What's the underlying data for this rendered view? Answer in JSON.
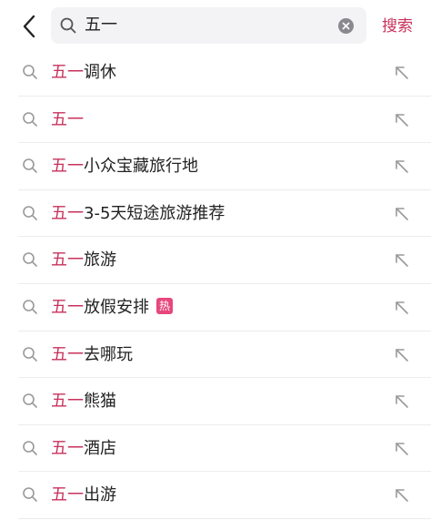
{
  "header": {
    "query": "五一",
    "search_label": "搜索"
  },
  "colors": {
    "accent": "#c7315c",
    "hot_badge": "#e6477d"
  },
  "suggestions": [
    {
      "prefix": "五一",
      "suffix": "调休",
      "badge": ""
    },
    {
      "prefix": "五一",
      "suffix": "",
      "badge": ""
    },
    {
      "prefix": "五一",
      "suffix": "小众宝藏旅行地",
      "badge": ""
    },
    {
      "prefix": "五一",
      "suffix": "3-5天短途旅游推荐",
      "badge": ""
    },
    {
      "prefix": "五一",
      "suffix": "旅游",
      "badge": ""
    },
    {
      "prefix": "五一",
      "suffix": "放假安排",
      "badge": "热"
    },
    {
      "prefix": "五一",
      "suffix": "去哪玩",
      "badge": ""
    },
    {
      "prefix": "五一",
      "suffix": "熊猫",
      "badge": ""
    },
    {
      "prefix": "五一",
      "suffix": "酒店",
      "badge": ""
    },
    {
      "prefix": "五一",
      "suffix": "出游",
      "badge": ""
    }
  ],
  "icons": {
    "back": "chevron-left-icon",
    "search": "search-icon",
    "clear": "clear-icon",
    "row": "search-icon",
    "fill": "arrow-up-left-icon"
  }
}
